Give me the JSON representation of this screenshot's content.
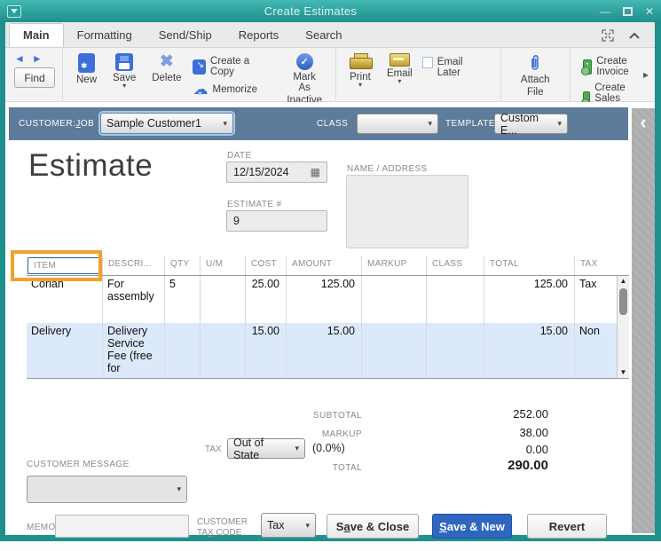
{
  "window": {
    "title": "Create Estimates"
  },
  "tabs": [
    {
      "label": "Main"
    },
    {
      "label": "Formatting"
    },
    {
      "label": "Send/Ship"
    },
    {
      "label": "Reports"
    },
    {
      "label": "Search"
    }
  ],
  "toolbar": {
    "find": "Find",
    "new": "New",
    "save": "Save",
    "delete": "Delete",
    "create_copy": "Create a Copy",
    "memorize": "Memorize",
    "mark_inactive_1": "Mark As",
    "mark_inactive_2": "Inactive",
    "print": "Print",
    "email": "Email",
    "email_later": "Email Later",
    "attach_1": "Attach",
    "attach_2": "File",
    "create_invoice": "Create Invoice",
    "create_sales_order": "Create Sales Order"
  },
  "customer_bar": {
    "customer_label": {
      "pre": "CUSTOMER:",
      "mn": "J",
      "post": "OB"
    },
    "customer_value": "Sample Customer1",
    "class_label": "CLASS",
    "class_value": "",
    "template_label": "TEMPLATE",
    "template_value": "Custom E..."
  },
  "form": {
    "heading": "Estimate",
    "date_label": "DATE",
    "date_value": "12/15/2024",
    "estimate_no_label": "ESTIMATE #",
    "estimate_no_value": "9",
    "name_address_label": "NAME / ADDRESS"
  },
  "table": {
    "columns": [
      "ITEM",
      "DESCRI...",
      "QTY",
      "U/M",
      "COST",
      "AMOUNT",
      "MARKUP",
      "CLASS",
      "TOTAL",
      "TAX"
    ],
    "rows": [
      {
        "item": "Corian",
        "description": "For assembly",
        "qty": "5",
        "um": "",
        "cost": "25.00",
        "amount": "125.00",
        "markup": "",
        "class": "",
        "total": "125.00",
        "tax": "Tax"
      },
      {
        "item": "Delivery",
        "description": "Delivery Service Fee (free for",
        "qty": "",
        "um": "",
        "cost": "15.00",
        "amount": "15.00",
        "markup": "",
        "class": "",
        "total": "15.00",
        "tax": "Non"
      }
    ]
  },
  "totals": {
    "subtotal_label": "SUBTOTAL",
    "subtotal": "252.00",
    "markup_label": "MARKUP",
    "markup": "38.00",
    "tax_label": "TAX",
    "tax_selected": "Out of State",
    "tax_rate": "(0.0%)",
    "tax_amount": "0.00",
    "total_label": "TOTAL",
    "total": "290.00"
  },
  "footer": {
    "customer_message_label": "CUSTOMER MESSAGE",
    "memo_label": "MEMO",
    "tax_code_label_1": "CUSTOMER",
    "tax_code_label_2": {
      "pre": "TA",
      "mn": "X",
      "post": " CODE"
    },
    "tax_code_value": "Tax",
    "save_close": {
      "pre": "S",
      "mn": "a",
      "post": "ve & Close"
    },
    "save_new": {
      "pre": "",
      "mn": "S",
      "post": "ave & New"
    },
    "revert": "Revert"
  },
  "icons": {
    "caret_down": "▾",
    "back_arrow": "◄",
    "forward_arrow": "►",
    "delete_x": "✖",
    "cloud": "☁",
    "check": "✓",
    "calendar": "▦",
    "scroll_up": "▲",
    "scroll_down": "▼",
    "panel_collapse": "‹",
    "toolbar_expand": "▸",
    "minimize": "—",
    "close": "✕"
  },
  "colors": {
    "titlebar_teal": "#2AA09B",
    "frame_teal": "#1F918C",
    "customer_bar_slate": "#5D7B9B",
    "row_alt_blue": "#DCE9FA",
    "primary_button_blue": "#2E66C0",
    "highlight_orange": "#F0A22E",
    "icon_blue": "#3E6FD8",
    "icon_gold": "#C3A12F",
    "icon_green": "#4CAF50"
  }
}
